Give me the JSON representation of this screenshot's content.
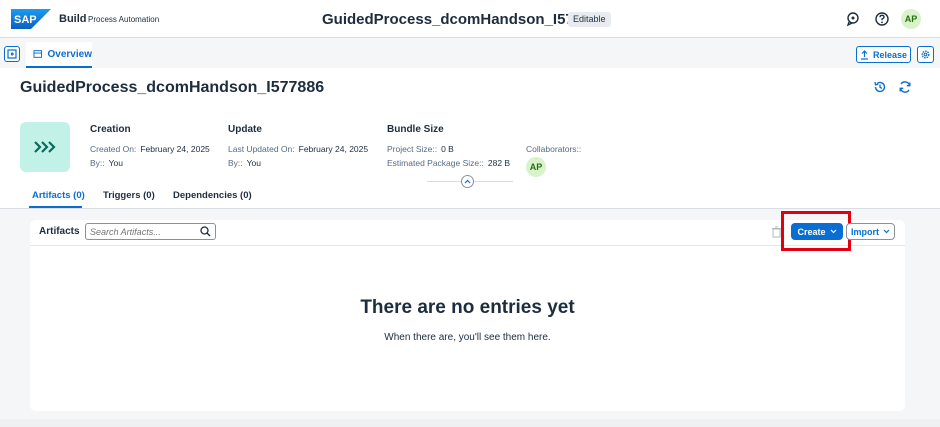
{
  "shell": {
    "logo_text": "SAP",
    "product": "Build",
    "subproduct": "Process Automation",
    "project_title": "GuidedProcess_dcomHandson_I577886",
    "badge": "Editable",
    "avatar_initials": "AP",
    "icons": [
      "notifications-icon",
      "help-icon"
    ]
  },
  "tabs": {
    "overview_label": "Overview",
    "release_label": "Release"
  },
  "header": {
    "title": "GuidedProcess_dcomHandson_I577886",
    "creation": {
      "label": "Creation",
      "created_on_label": "Created On:",
      "created_on_value": "February 24, 2025",
      "by_label": "By::",
      "by_value": "You"
    },
    "update": {
      "label": "Update",
      "last_updated_label": "Last Updated On:",
      "last_updated_value": "February 24, 2025",
      "by_label": "By::",
      "by_value": "You"
    },
    "bundle": {
      "label": "Bundle Size",
      "project_size_label": "Project Size::",
      "project_size_value": "0 B",
      "package_size_label": "Estimated Package Size::",
      "package_size_value": "282 B"
    },
    "collaborators_label": "Collaborators::",
    "collaborator_initials": "AP",
    "tile_color": "#c2f2e7"
  },
  "subtabs": [
    {
      "label": "Artifacts (0)",
      "active": true
    },
    {
      "label": "Triggers (0)",
      "active": false
    },
    {
      "label": "Dependencies (0)",
      "active": false
    }
  ],
  "artifacts": {
    "label": "Artifacts",
    "search_placeholder": "Search Artifacts...",
    "create_label": "Create",
    "import_label": "Import",
    "empty_title": "There are no entries yet",
    "empty_subtitle": "When there are, you'll see them here."
  },
  "colors": {
    "accent": "#0a6ed1",
    "highlight": "#e00012",
    "background": "#f5f6f7"
  }
}
